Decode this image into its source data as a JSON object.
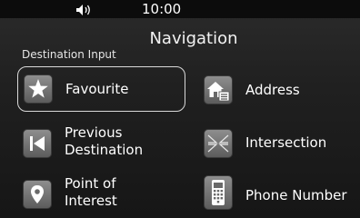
{
  "status": {
    "time": "10:00",
    "volume_icon": "speaker-icon"
  },
  "header": {
    "title": "Navigation",
    "section_label": "Destination Input"
  },
  "menu": [
    {
      "label": "Favourite",
      "icon": "star-icon",
      "selected": true
    },
    {
      "label": "Address",
      "icon": "house-icon",
      "selected": false
    },
    {
      "label": "Previous\nDestination",
      "icon": "previous-destination-icon",
      "selected": false
    },
    {
      "label": "Intersection",
      "icon": "intersection-icon",
      "selected": false
    },
    {
      "label": "Point of\nInterest",
      "icon": "map-pin-icon",
      "selected": false
    },
    {
      "label": "Phone Number",
      "icon": "phone-icon",
      "selected": false
    }
  ]
}
